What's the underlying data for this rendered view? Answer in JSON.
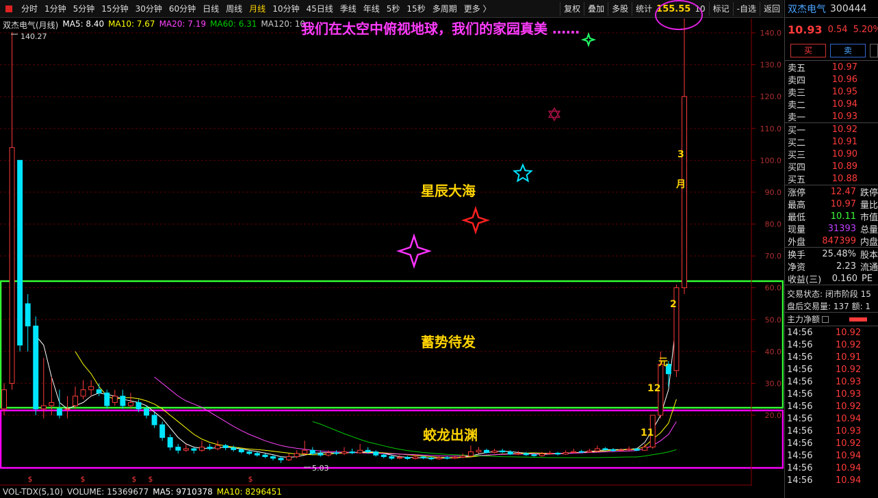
{
  "toolbar": {
    "items": [
      "分时",
      "1分钟",
      "5分钟",
      "15分钟",
      "30分钟",
      "60分钟",
      "日线",
      "周线",
      "月线",
      "10分钟",
      "45日线",
      "季线",
      "年线",
      "5秒",
      "15秒",
      "多周期",
      "更多 〉"
    ],
    "active_index": 8,
    "right_buttons": {
      "restore": "复权",
      "overlay": "叠加",
      "multi": "多股",
      "stats": "统计",
      "mark": "标记",
      "watchlist": "-自选",
      "back": "返回"
    },
    "peak_price": "155.55",
    "right_digit": "10"
  },
  "legend": {
    "title": "双杰电气(月线)",
    "ma5": "MA5: 8.40",
    "ma10": "MA10: 7.67",
    "ma20": "MA20: 7.19",
    "ma60": "MA60: 6.31",
    "ma120": "MA120: 10"
  },
  "caption": "我们在太空中俯视地球，我们的家园真美 ……",
  "annotations": {
    "zone_top": "星辰大海",
    "zone_mid": "蓄势待发",
    "zone_bottom": "蛟龙出渊",
    "marks": [
      "3",
      "月",
      "2",
      "元",
      "12",
      "11"
    ],
    "high_label": "140.27",
    "low_label": "5.03"
  },
  "chart_data": {
    "type": "candlestick",
    "title": "双杰电气(月线)",
    "ylim": [
      0,
      145
    ],
    "y_ticks": [
      20.0,
      30.0,
      40.0,
      50.0,
      60.0,
      70.0,
      80.0,
      90.0,
      100.0,
      110.0,
      120.0,
      130.0,
      140.0
    ],
    "series": [
      {
        "name": "MA5",
        "color": "#ffffff"
      },
      {
        "name": "MA10",
        "color": "#ffff00"
      },
      {
        "name": "MA20",
        "color": "#ff44ff"
      },
      {
        "name": "MA60",
        "color": "#00cc00"
      },
      {
        "name": "MA120",
        "color": "#cccccc"
      }
    ],
    "candles": [
      {
        "o": 22,
        "c": 28,
        "h": 30,
        "l": 20
      },
      {
        "o": 30,
        "c": 104,
        "h": 140.27,
        "l": 28
      },
      {
        "o": 100,
        "c": 42,
        "h": 100,
        "l": 40
      },
      {
        "o": 55,
        "c": 48,
        "h": 58,
        "l": 40
      },
      {
        "o": 48,
        "c": 22,
        "h": 51,
        "l": 20
      },
      {
        "o": 22,
        "c": 23,
        "h": 38,
        "l": 19
      },
      {
        "o": 23,
        "c": 24,
        "h": 32,
        "l": 20
      },
      {
        "o": 22,
        "c": 20,
        "h": 28,
        "l": 19
      },
      {
        "o": 22,
        "c": 22,
        "h": 26,
        "l": 19
      },
      {
        "o": 23,
        "c": 26,
        "h": 29,
        "l": 22
      },
      {
        "o": 26,
        "c": 28,
        "h": 31,
        "l": 25
      },
      {
        "o": 28,
        "c": 29,
        "h": 31,
        "l": 26
      },
      {
        "o": 28,
        "c": 27,
        "h": 30,
        "l": 26
      },
      {
        "o": 27,
        "c": 23,
        "h": 28,
        "l": 22
      },
      {
        "o": 24,
        "c": 26,
        "h": 28,
        "l": 23
      },
      {
        "o": 26,
        "c": 23,
        "h": 28,
        "l": 22
      },
      {
        "o": 23,
        "c": 24,
        "h": 27,
        "l": 22
      },
      {
        "o": 24,
        "c": 22,
        "h": 25,
        "l": 21
      },
      {
        "o": 22,
        "c": 20,
        "h": 23,
        "l": 19
      },
      {
        "o": 20,
        "c": 17,
        "h": 21,
        "l": 16
      },
      {
        "o": 17,
        "c": 13,
        "h": 18,
        "l": 12
      },
      {
        "o": 13,
        "c": 10,
        "h": 14,
        "l": 9
      },
      {
        "o": 10,
        "c": 9,
        "h": 11,
        "l": 8
      },
      {
        "o": 9,
        "c": 9.5,
        "h": 11,
        "l": 8.5
      },
      {
        "o": 9.5,
        "c": 9,
        "h": 10,
        "l": 8
      },
      {
        "o": 9,
        "c": 10,
        "h": 12,
        "l": 8.5
      },
      {
        "o": 10,
        "c": 9.5,
        "h": 11,
        "l": 9
      },
      {
        "o": 9.5,
        "c": 10.5,
        "h": 12,
        "l": 9
      },
      {
        "o": 10.5,
        "c": 9.8,
        "h": 11,
        "l": 9
      },
      {
        "o": 9.8,
        "c": 9.2,
        "h": 10.5,
        "l": 8.6
      },
      {
        "o": 9.2,
        "c": 8.5,
        "h": 9.5,
        "l": 8
      },
      {
        "o": 8.5,
        "c": 8,
        "h": 9,
        "l": 7.5
      },
      {
        "o": 8,
        "c": 7.5,
        "h": 8.5,
        "l": 7
      },
      {
        "o": 7.5,
        "c": 7,
        "h": 8,
        "l": 6.5
      },
      {
        "o": 7,
        "c": 6.5,
        "h": 7.5,
        "l": 5.8
      },
      {
        "o": 6.5,
        "c": 6,
        "h": 7,
        "l": 5.03
      },
      {
        "o": 6,
        "c": 7,
        "h": 8,
        "l": 5.6
      },
      {
        "o": 7,
        "c": 8,
        "h": 9,
        "l": 6.5
      },
      {
        "o": 8,
        "c": 9,
        "h": 12,
        "l": 7.5
      },
      {
        "o": 9,
        "c": 8,
        "h": 10,
        "l": 7.5
      },
      {
        "o": 8,
        "c": 7.5,
        "h": 9,
        "l": 7
      },
      {
        "o": 7.5,
        "c": 8.2,
        "h": 9,
        "l": 7
      },
      {
        "o": 8.2,
        "c": 8,
        "h": 9,
        "l": 7.5
      },
      {
        "o": 8,
        "c": 8.5,
        "h": 10,
        "l": 7.5
      },
      {
        "o": 8.5,
        "c": 8.2,
        "h": 9.5,
        "l": 7.8
      },
      {
        "o": 8.2,
        "c": 9,
        "h": 11,
        "l": 8
      },
      {
        "o": 9,
        "c": 8.5,
        "h": 10,
        "l": 8
      },
      {
        "o": 8.5,
        "c": 7.5,
        "h": 9,
        "l": 7
      },
      {
        "o": 7.5,
        "c": 7,
        "h": 8,
        "l": 6.5
      },
      {
        "o": 7,
        "c": 6.5,
        "h": 7.5,
        "l": 6
      },
      {
        "o": 6.5,
        "c": 6.8,
        "h": 7.5,
        "l": 6.2
      },
      {
        "o": 6.8,
        "c": 6.4,
        "h": 7.2,
        "l": 6
      },
      {
        "o": 6.4,
        "c": 6.9,
        "h": 7.8,
        "l": 6.1
      },
      {
        "o": 6.9,
        "c": 6.6,
        "h": 7.3,
        "l": 6.2
      },
      {
        "o": 6.6,
        "c": 6.3,
        "h": 7,
        "l": 5.9
      },
      {
        "o": 6.3,
        "c": 6.7,
        "h": 7.2,
        "l": 6
      },
      {
        "o": 6.7,
        "c": 6.5,
        "h": 7.1,
        "l": 6.1
      },
      {
        "o": 6.5,
        "c": 6.8,
        "h": 7.4,
        "l": 6.2
      },
      {
        "o": 6.8,
        "c": 7.2,
        "h": 8,
        "l": 6.5
      },
      {
        "o": 7.2,
        "c": 8.5,
        "h": 10.5,
        "l": 7
      },
      {
        "o": 8.5,
        "c": 9,
        "h": 10,
        "l": 8
      },
      {
        "o": 9,
        "c": 8.3,
        "h": 9.5,
        "l": 8
      },
      {
        "o": 8.3,
        "c": 8.8,
        "h": 9.5,
        "l": 8
      },
      {
        "o": 8.8,
        "c": 8.5,
        "h": 9.5,
        "l": 8.1
      },
      {
        "o": 8.5,
        "c": 7.8,
        "h": 9,
        "l": 7.5
      },
      {
        "o": 7.8,
        "c": 8,
        "h": 8.8,
        "l": 7.5
      },
      {
        "o": 8,
        "c": 7.6,
        "h": 8.5,
        "l": 7.2
      },
      {
        "o": 7.6,
        "c": 7.3,
        "h": 8,
        "l": 7
      },
      {
        "o": 7.3,
        "c": 7.9,
        "h": 8.5,
        "l": 7
      },
      {
        "o": 7.9,
        "c": 8.1,
        "h": 8.8,
        "l": 7.6
      },
      {
        "o": 8.1,
        "c": 7.8,
        "h": 8.5,
        "l": 7.4
      },
      {
        "o": 7.8,
        "c": 8.3,
        "h": 9,
        "l": 7.6
      },
      {
        "o": 8.3,
        "c": 8.6,
        "h": 9.5,
        "l": 8
      },
      {
        "o": 8.6,
        "c": 8.4,
        "h": 9.2,
        "l": 8.1
      },
      {
        "o": 8.4,
        "c": 8.8,
        "h": 9.5,
        "l": 8.2
      },
      {
        "o": 8.8,
        "c": 9.5,
        "h": 10.5,
        "l": 8.5
      },
      {
        "o": 9.5,
        "c": 9.2,
        "h": 10,
        "l": 8.8
      },
      {
        "o": 9.2,
        "c": 8.9,
        "h": 9.7,
        "l": 8.6
      },
      {
        "o": 8.9,
        "c": 9.1,
        "h": 9.6,
        "l": 8.7
      },
      {
        "o": 9.1,
        "c": 9.4,
        "h": 10.2,
        "l": 8.9
      },
      {
        "o": 9.4,
        "c": 9,
        "h": 9.8,
        "l": 8.8
      },
      {
        "o": 9,
        "c": 10,
        "h": 11,
        "l": 8.9
      },
      {
        "o": 10,
        "c": 20,
        "h": 20,
        "l": 9.5
      },
      {
        "o": 20,
        "c": 36,
        "h": 40,
        "l": 19
      },
      {
        "o": 36,
        "c": 33,
        "h": 37,
        "l": 29
      },
      {
        "o": 34,
        "c": 60,
        "h": 61,
        "l": 32
      },
      {
        "o": 60,
        "c": 120,
        "h": 155.55,
        "l": 58
      }
    ],
    "ma_lines": {
      "MA5": [
        null,
        null,
        null,
        null,
        45,
        42,
        32,
        24,
        22,
        23,
        24,
        26,
        27,
        26.5,
        26,
        25,
        24.5,
        24,
        23,
        21,
        19,
        16,
        13,
        11,
        10,
        9.6,
        9.6,
        9.8,
        10,
        9.8,
        9.4,
        9,
        8.6,
        8.1,
        7.6,
        7,
        6.8,
        7,
        7.5,
        8,
        8.2,
        8.3,
        8.1,
        8.2,
        8.3,
        8.4,
        8.6,
        8.4,
        8,
        7.5,
        7,
        6.8,
        6.7,
        6.6,
        6.6,
        6.5,
        6.6,
        6.6,
        6.8,
        7.2,
        7.8,
        8.3,
        8.6,
        8.7,
        8.6,
        8.3,
        8.1,
        7.9,
        7.7,
        7.8,
        7.9,
        8,
        8.2,
        8.4,
        8.6,
        8.9,
        9.1,
        9.2,
        9.2,
        9.3,
        9.5,
        11.5,
        15.5,
        20,
        28,
        50
      ],
      "MA10": [
        null,
        null,
        null,
        null,
        null,
        null,
        null,
        null,
        null,
        40,
        36,
        33,
        29,
        26,
        25,
        25.5,
        25.5,
        25.2,
        24.5,
        23.5,
        22,
        20,
        18,
        16,
        14,
        12.5,
        11.5,
        10.8,
        10.4,
        10,
        9.7,
        9.4,
        9.2,
        9,
        8.7,
        8.4,
        8.1,
        7.8,
        7.7,
        7.6,
        7.6,
        7.8,
        8,
        8.2,
        8.3,
        8.3,
        8.3,
        8.3,
        8.2,
        8,
        7.8,
        7.6,
        7.4,
        7.2,
        7,
        6.8,
        6.7,
        6.7,
        6.8,
        6.9,
        7.2,
        7.4,
        7.6,
        7.8,
        7.9,
        8,
        8.1,
        8.2,
        8.1,
        8,
        8,
        8.1,
        8.2,
        8.3,
        8.4,
        8.6,
        8.8,
        9,
        9.1,
        9.2,
        9.3,
        10.2,
        12.5,
        14.5,
        17.5,
        25
      ],
      "MA20": [
        null,
        null,
        null,
        null,
        null,
        null,
        null,
        null,
        null,
        null,
        null,
        null,
        null,
        null,
        null,
        null,
        null,
        null,
        null,
        32,
        30,
        28,
        26,
        24.5,
        23.5,
        22.5,
        21,
        19.5,
        18,
        16.5,
        15.2,
        14,
        13,
        12,
        11.2,
        10.5,
        10,
        9.6,
        9.3,
        9,
        8.8,
        8.6,
        8.5,
        8.4,
        8.3,
        8.2,
        8.1,
        8.1,
        8,
        7.9,
        7.8,
        7.7,
        7.6,
        7.5,
        7.4,
        7.3,
        7.2,
        7.2,
        7.2,
        7.3,
        7.4,
        7.5,
        7.6,
        7.7,
        7.8,
        7.8,
        7.8,
        7.9,
        7.9,
        7.9,
        8,
        8,
        8.1,
        8.2,
        8.3,
        8.4,
        8.5,
        8.6,
        8.7,
        8.8,
        8.9,
        9.5,
        10.5,
        12,
        14,
        18
      ],
      "MA60": [
        null,
        null,
        null,
        null,
        null,
        null,
        null,
        null,
        null,
        null,
        null,
        null,
        null,
        null,
        null,
        null,
        null,
        null,
        null,
        null,
        null,
        null,
        null,
        null,
        null,
        null,
        null,
        null,
        null,
        null,
        null,
        null,
        null,
        null,
        null,
        null,
        null,
        null,
        null,
        18,
        17.2,
        16.2,
        15.2,
        14.2,
        13.3,
        12.4,
        11.6,
        11,
        10.4,
        9.8,
        9.3,
        8.9,
        8.6,
        8.3,
        8.1,
        7.9,
        7.7,
        7.6,
        7.5,
        7.4,
        7.3,
        7.2,
        7.1,
        7,
        6.95,
        6.9,
        6.85,
        6.8,
        6.75,
        6.7,
        6.7,
        6.7,
        6.7,
        6.7,
        6.7,
        6.7,
        6.75,
        6.8,
        6.85,
        6.9,
        6.9,
        7.2,
        7.6,
        8,
        8.5,
        9.2
      ]
    },
    "volume_legend": {
      "indicator": "VOL-TDX(5,10)",
      "volume": "VOLUME: 15369677",
      "ma5": "MA5: 9710378",
      "ma10": "MA10: 8296451"
    }
  },
  "quote": {
    "name": "双杰电气",
    "code": "300444",
    "price": "10.93",
    "change": "0.54",
    "change_pct": "5.20%",
    "buy_label": "买",
    "sell_label": "卖",
    "asks": [
      {
        "label": "卖五",
        "price": "10.97"
      },
      {
        "label": "卖四",
        "price": "10.96"
      },
      {
        "label": "卖三",
        "price": "10.95"
      },
      {
        "label": "卖二",
        "price": "10.94"
      },
      {
        "label": "卖一",
        "price": "10.93"
      }
    ],
    "bids": [
      {
        "label": "买一",
        "price": "10.92"
      },
      {
        "label": "买二",
        "price": "10.91"
      },
      {
        "label": "买三",
        "price": "10.90"
      },
      {
        "label": "买四",
        "price": "10.89"
      },
      {
        "label": "买五",
        "price": "10.88"
      }
    ],
    "stats": [
      {
        "label": "涨停",
        "value": "12.47",
        "color": "red",
        "ext": "跌停"
      },
      {
        "label": "最高",
        "value": "10.97",
        "color": "red",
        "ext": "量比"
      },
      {
        "label": "最低",
        "value": "10.11",
        "color": "green",
        "ext": "市值"
      },
      {
        "label": "现量",
        "value": "31393",
        "color": "purple",
        "ext": "总量"
      },
      {
        "label": "外盘",
        "value": "847399",
        "color": "red",
        "ext": "内盘"
      }
    ],
    "stats2": [
      {
        "label": "换手",
        "value": "25.48%",
        "ext": "股本"
      },
      {
        "label": "净资",
        "value": "2.23",
        "ext": "流通"
      },
      {
        "label": "收益(三)",
        "value": "0.160",
        "ext": "PE"
      }
    ],
    "trade_status": "交易状态: 闭市阶段 15",
    "after_hours": "盘后交易量: 137  额: 1",
    "net_inflow_label": "主力净额",
    "trades": [
      {
        "time": "14:56",
        "price": "10.92"
      },
      {
        "time": "14:56",
        "price": "10.92"
      },
      {
        "time": "14:56",
        "price": "10.91"
      },
      {
        "time": "14:56",
        "price": "10.92"
      },
      {
        "time": "14:56",
        "price": "10.93"
      },
      {
        "time": "14:56",
        "price": "10.93"
      },
      {
        "time": "14:56",
        "price": "10.92"
      },
      {
        "time": "14:56",
        "price": "10.94"
      },
      {
        "time": "14:56",
        "price": "10.93"
      },
      {
        "time": "14:56",
        "price": "10.92"
      },
      {
        "time": "14:56",
        "price": "10.94"
      },
      {
        "time": "14:56",
        "price": "10.94"
      },
      {
        "time": "14:56",
        "price": "10.94"
      }
    ]
  }
}
